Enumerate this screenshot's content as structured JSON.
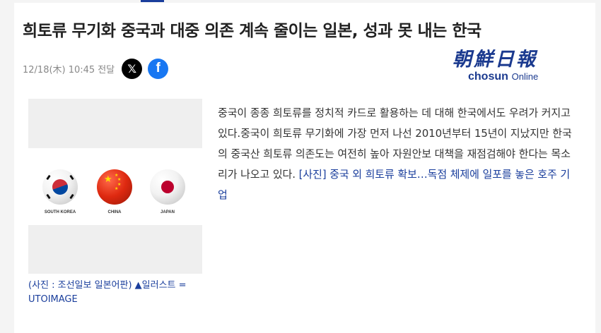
{
  "article": {
    "headline": "희토류 무기화 중국과 대중 의존 계속 줄이는 일본, 성과 못 내는 한국",
    "date": "12/18(木) 10:45",
    "share_label": "전달"
  },
  "share": {
    "x_icon": "x-logo-icon",
    "x_glyph": "𝕏",
    "facebook_icon": "facebook-logo-icon",
    "facebook_glyph": "f"
  },
  "logo": {
    "name": "朝鮮日報",
    "brand": "chosun",
    "suffix": "Online"
  },
  "photo": {
    "flags": [
      {
        "label": "SOUTH KOREA"
      },
      {
        "label": "CHINA"
      },
      {
        "label": "JAPAN"
      }
    ],
    "caption": "(사진 : 조선일보 일본어판) ▲일러스트 = UTOIMAGE"
  },
  "body": {
    "paragraph": "중국이 종종 희토류를 정치적 카드로 활용하는 데 대해 한국에서도 우려가 커지고 있다.중국이 희토류 무기화에 가장 먼저 나선 2010년부터 15년이 지났지만 한국의 중국산 희토류 의존도는 여전히 높아 자원안보 대책을 재점검해야 한다는 목소리가 나오고 있다. ",
    "related_link": "[사진] 중국 외 희토류 확보…독점 체제에 일포를 놓은 호주 기업"
  },
  "colors": {
    "accent": "#1a3e9c",
    "x_bg": "#000000",
    "facebook_bg": "#1877f2"
  }
}
